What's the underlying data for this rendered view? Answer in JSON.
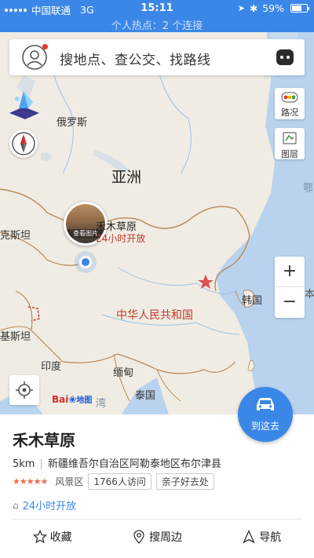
{
  "status_bar": {
    "carrier": "中国联通",
    "network": "3G",
    "time": "15:11",
    "battery": "59%",
    "hotspot": "个人热点：2 个连接"
  },
  "search": {
    "placeholder": "搜地点、查公交、找路线"
  },
  "controls": {
    "traffic_label": "路况",
    "layers_label": "图层",
    "zoom_in": "+",
    "zoom_out": "−"
  },
  "map": {
    "labels": {
      "russia": "俄罗斯",
      "asia": "亚洲",
      "kazakh": "克斯坦",
      "china": "中华人民共和国",
      "korea": "韩国",
      "pakistan": "基斯坦",
      "india": "印度",
      "myanmar": "缅甸",
      "thailand": "泰国",
      "sea1": "鄂",
      "sea2": "本",
      "bay": "湾"
    },
    "pin": {
      "name": "禾木草原",
      "hours": "24小时开放",
      "photo_caption": "查看图片"
    },
    "logo": {
      "bai": "Bai",
      "du": "du",
      "suffix": "地图"
    }
  },
  "route_button": {
    "label": "到这去"
  },
  "place": {
    "name": "禾木草原",
    "distance": "5km",
    "address": "新疆维吾尔自治区阿勒泰地区布尔津县",
    "stars": "★★★★★",
    "rating": 4.5,
    "category": "风景区",
    "visits": "1766人访问",
    "tag": "亲子好去处",
    "hours": "24小时开放"
  },
  "actions": {
    "favorite": "收藏",
    "nearby": "搜周边",
    "navigate": "导航"
  }
}
